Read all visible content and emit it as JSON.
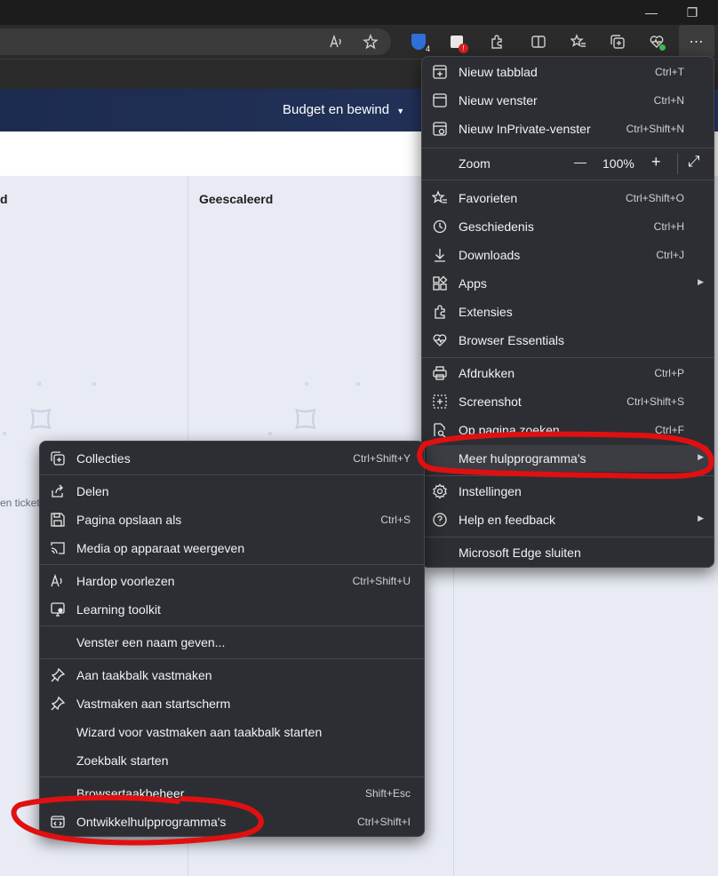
{
  "window": {
    "minimize_glyph": "—",
    "restore_glyph": "❐"
  },
  "site": {
    "nav_label": "Budget en bewind",
    "column_left_title": "d",
    "column_title": "Geescaleerd",
    "snippet": "en ticket"
  },
  "main_menu": {
    "items": [
      {
        "label": "Nieuw tabblad",
        "shortcut": "Ctrl+T",
        "icon": "new-tab-icon"
      },
      {
        "label": "Nieuw venster",
        "shortcut": "Ctrl+N",
        "icon": "new-window-icon"
      },
      {
        "label": "Nieuw InPrivate-venster",
        "shortcut": "Ctrl+Shift+N",
        "icon": "inprivate-icon"
      },
      {
        "label": "Favorieten",
        "shortcut": "Ctrl+Shift+O",
        "icon": "favorites-icon"
      },
      {
        "label": "Geschiedenis",
        "shortcut": "Ctrl+H",
        "icon": "history-icon"
      },
      {
        "label": "Downloads",
        "shortcut": "Ctrl+J",
        "icon": "download-icon"
      },
      {
        "label": "Apps",
        "shortcut": "",
        "icon": "apps-icon"
      },
      {
        "label": "Extensies",
        "shortcut": "",
        "icon": "extensions-icon"
      },
      {
        "label": "Browser Essentials",
        "shortcut": "",
        "icon": "heart-pulse-icon"
      },
      {
        "label": "Afdrukken",
        "shortcut": "Ctrl+P",
        "icon": "print-icon"
      },
      {
        "label": "Screenshot",
        "shortcut": "Ctrl+Shift+S",
        "icon": "screenshot-icon"
      },
      {
        "label": "Op pagina zoeken",
        "shortcut": "Ctrl+F",
        "icon": "find-icon"
      },
      {
        "label": "Meer hulpprogramma's",
        "shortcut": "",
        "icon": ""
      },
      {
        "label": "Instellingen",
        "shortcut": "",
        "icon": "settings-icon"
      },
      {
        "label": "Help en feedback",
        "shortcut": "",
        "icon": "help-icon"
      },
      {
        "label": "Microsoft Edge sluiten",
        "shortcut": "",
        "icon": ""
      }
    ],
    "zoom": {
      "label": "Zoom",
      "value": "100%",
      "minus": "—",
      "plus": "+",
      "fullscreen": "⤢"
    }
  },
  "sub_menu": {
    "items": [
      {
        "label": "Collecties",
        "shortcut": "Ctrl+Shift+Y",
        "icon": "collections-icon"
      },
      {
        "label": "Delen",
        "shortcut": "",
        "icon": "share-icon"
      },
      {
        "label": "Pagina opslaan als",
        "shortcut": "Ctrl+S",
        "icon": "save-icon"
      },
      {
        "label": "Media op apparaat weergeven",
        "shortcut": "",
        "icon": "cast-icon"
      },
      {
        "label": "Hardop voorlezen",
        "shortcut": "Ctrl+Shift+U",
        "icon": "read-aloud-icon"
      },
      {
        "label": "Learning toolkit",
        "shortcut": "",
        "icon": "learning-icon"
      },
      {
        "label": "Venster een naam geven...",
        "shortcut": "",
        "icon": ""
      },
      {
        "label": "Aan taakbalk vastmaken",
        "shortcut": "",
        "icon": "pin-icon"
      },
      {
        "label": "Vastmaken aan startscherm",
        "shortcut": "",
        "icon": "pin-icon"
      },
      {
        "label": "Wizard voor vastmaken aan taakbalk starten",
        "shortcut": "",
        "icon": ""
      },
      {
        "label": "Zoekbalk starten",
        "shortcut": "",
        "icon": ""
      },
      {
        "label": "Browsertaakbeheer",
        "shortcut": "Shift+Esc",
        "icon": ""
      },
      {
        "label": "Ontwikkelhulpprogramma's",
        "shortcut": "Ctrl+Shift+I",
        "icon": "devtools-icon"
      }
    ]
  },
  "toolbar": {
    "extension_badge_count": "4",
    "extension_alert": "!"
  },
  "colors": {
    "menu_bg": "#2d2e33",
    "annotation": "#e01010",
    "header": "#1f2d50"
  }
}
